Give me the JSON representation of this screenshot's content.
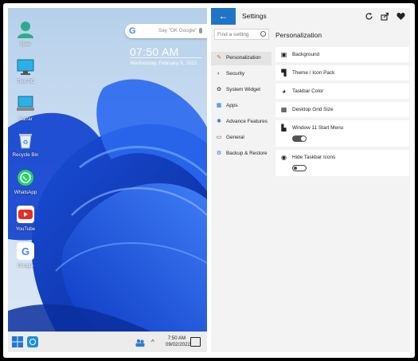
{
  "phone": {
    "desktop_icons": [
      {
        "label": "User",
        "icon": "user-icon"
      },
      {
        "label": "This PC",
        "icon": "monitor-icon"
      },
      {
        "label": "Narrar",
        "icon": "network-icon"
      },
      {
        "label": "Recycle Bin",
        "icon": "recycle-bin-icon"
      },
      {
        "label": "WhatsApp",
        "icon": "whatsapp-icon"
      },
      {
        "label": "YouTube",
        "icon": "youtube-icon"
      },
      {
        "label": "Google",
        "icon": "google-icon"
      }
    ],
    "search": {
      "g": "G",
      "placeholder": "Say \"OK Google\""
    },
    "clock": {
      "time": "07:50 AM",
      "date": "Wednesday, February 9, 2022"
    },
    "taskbar": {
      "time": "7:50 AM",
      "date": "09/02/2022",
      "caret": "^"
    }
  },
  "settings": {
    "back": "←",
    "title": "Settings",
    "header_icons": [
      "refresh-icon",
      "share-icon",
      "heart-icon"
    ],
    "search_placeholder": "Find a setting",
    "nav": [
      {
        "label": "Personalization",
        "icon": "brush-icon",
        "active": true
      },
      {
        "label": "Security",
        "icon": "shield-icon"
      },
      {
        "label": "System Widget",
        "icon": "widget-icon"
      },
      {
        "label": "Apps",
        "icon": "apps-icon"
      },
      {
        "label": "Advance Features",
        "icon": "advanced-icon"
      },
      {
        "label": "General",
        "icon": "general-icon"
      },
      {
        "label": "Backup & Restore",
        "icon": "gear-icon"
      }
    ],
    "section_title": "Personalization",
    "rows": [
      {
        "label": "Background",
        "icon": "image-icon"
      },
      {
        "label": "Theme / Icon Pack",
        "icon": "paint-roller-icon"
      },
      {
        "label": "Taskbar Color",
        "icon": "palette-icon"
      },
      {
        "label": "Desktop Grid Size",
        "icon": "grid-icon"
      },
      {
        "label": "Window 11 Start Menu",
        "icon": "start-menu-icon",
        "toggle": "on"
      },
      {
        "label": "Hide Taskbar Icons",
        "icon": "eye-off-icon",
        "toggle": "off"
      }
    ]
  }
}
